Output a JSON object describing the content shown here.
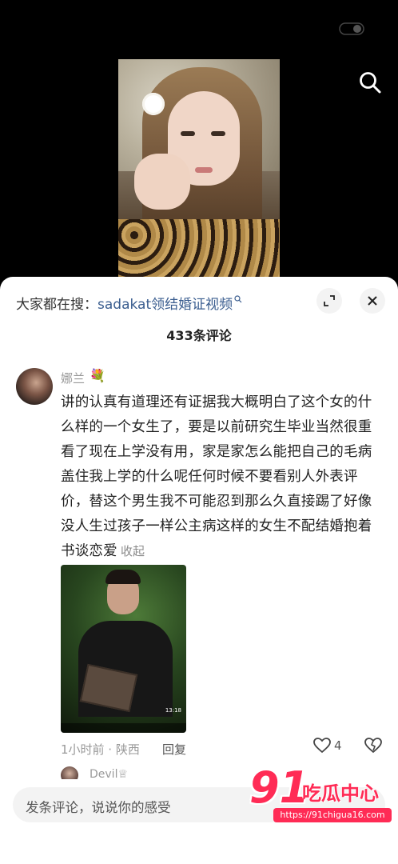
{
  "video": {
    "icons": {
      "search": "search-icon",
      "toggle": "toggle-icon"
    }
  },
  "header": {
    "hot_search_prefix": "大家都在搜：",
    "hot_search_term": "sadakat领结婚证视频",
    "expand_icon": "expand-icon",
    "close_icon": "close-icon"
  },
  "comment_count": "433条评论",
  "comment": {
    "username": "娜兰",
    "username_emoji": "💐",
    "text": "讲的认真有道理还有证据我大概明白了这个女的什么样的一个女生了，要是以前研究生毕业当然很重看了现在上学没有用，家是家怎么能把自己的毛病盖住我上学的什么呢任何时候不要看别人外表评价，替这个男生我不可能忍到那么久直接踢了好像没人生过孩子一样公主病这样的女生不配结婚抱着书谈恋爱",
    "collapse_label": "收起",
    "image": {
      "timecode": "13:18"
    },
    "meta": "1小时前 · 陕西",
    "reply_label": "回复",
    "like_count": "4"
  },
  "next_comment": {
    "username": "Devil♕"
  },
  "input": {
    "placeholder": "发条评论，说说你的感受"
  },
  "watermark": {
    "number": "91",
    "brand": "吃瓜中心",
    "url": "https://91chigua16.com"
  },
  "colors": {
    "accent": "#ff2b55",
    "link": "#3a5d8f"
  }
}
